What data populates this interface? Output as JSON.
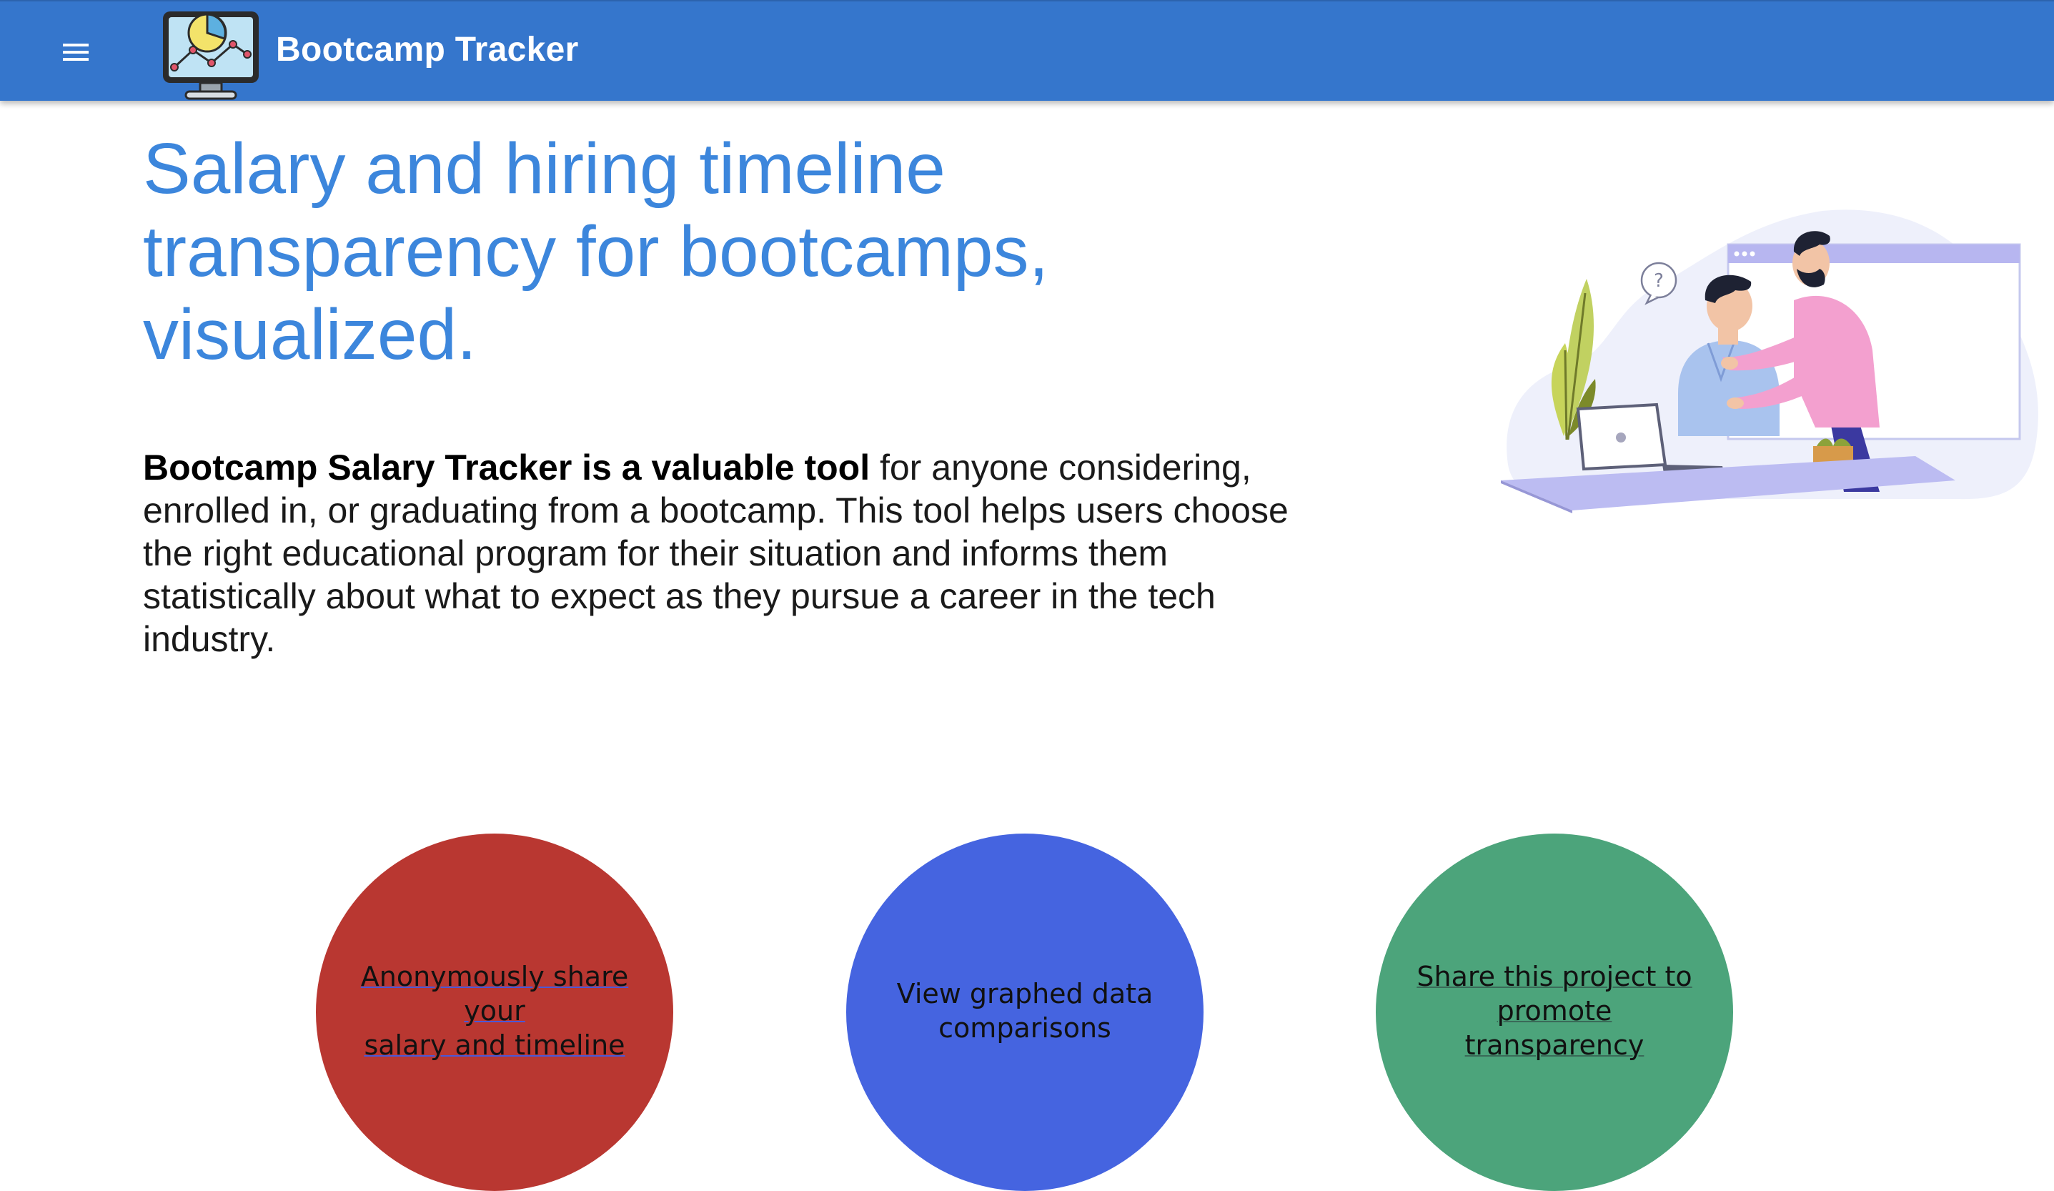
{
  "header": {
    "app_title": "Bootcamp Tracker",
    "menu_icon": "hamburger-menu-icon",
    "logo_icon": "monitor-chart-icon",
    "bar_color": "#3576cc"
  },
  "hero": {
    "title_lines": [
      "Salary and hiring timeline",
      "transparency for bootcamps,",
      "visualized."
    ],
    "title_color": "#3c86dc"
  },
  "intro": {
    "bold_text": "Bootcamp Salary Tracker is a valuable tool",
    "lines": [
      " for anyone considering,",
      "enrolled in, or graduating from a bootcamp. This tool helps users choose",
      "the right educational program for their situation and informs them",
      "statistically about what to expect as they pursue a career in the tech",
      "industry."
    ]
  },
  "illustration": {
    "icon": "mentor-helping-student-illustration"
  },
  "actions": [
    {
      "label_line1": "Anonymously share your",
      "label_line2": "salary and timeline",
      "color": "#b93731"
    },
    {
      "label_line1": "View graphed data",
      "label_line2": "comparisons",
      "color": "#4564e0"
    },
    {
      "label_line1": "Share this project to",
      "label_line2": "promote transparency",
      "color": "#4ca47b"
    }
  ]
}
